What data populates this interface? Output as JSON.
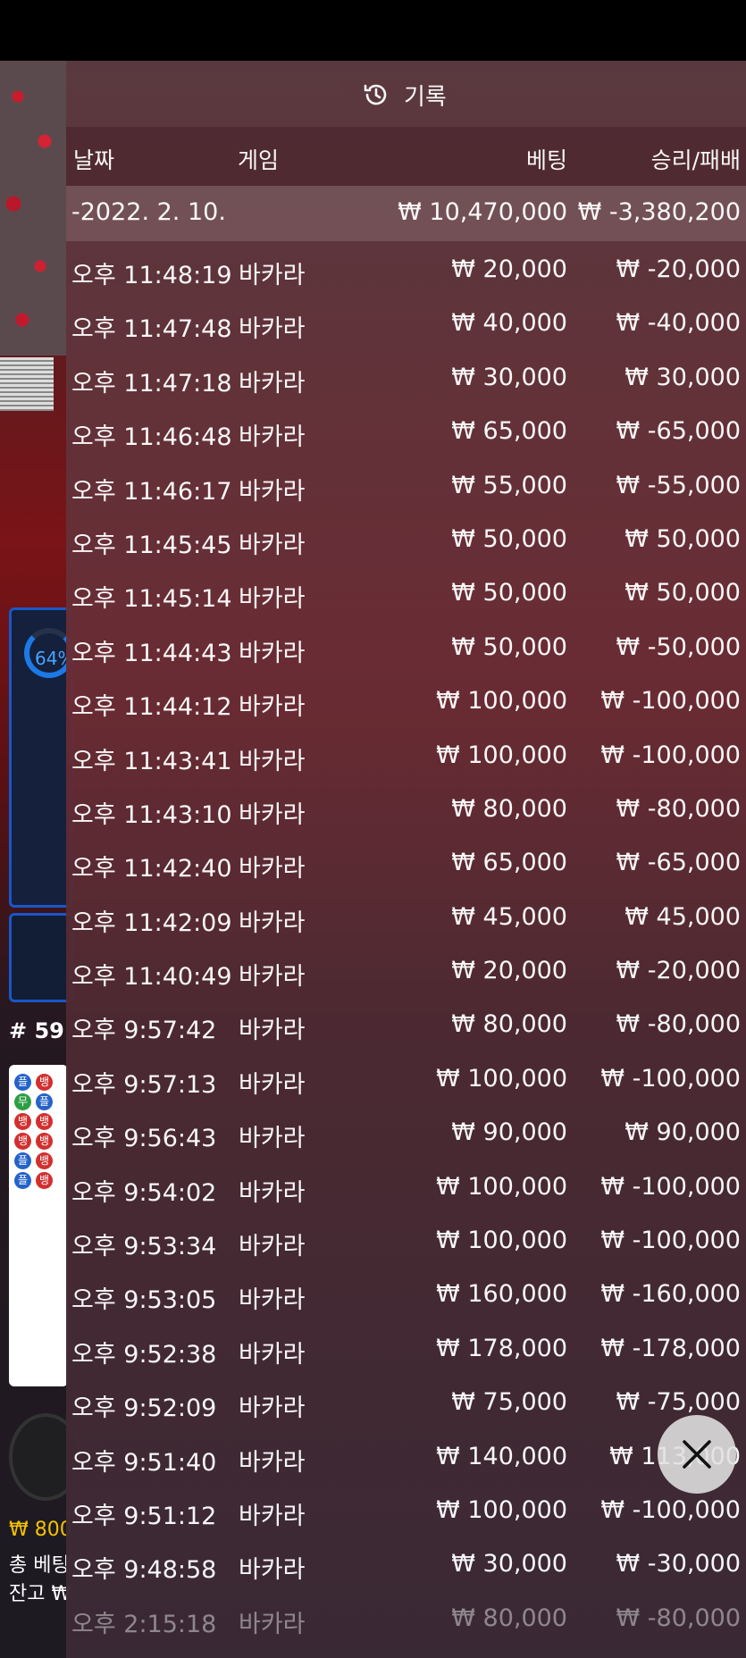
{
  "header": {
    "title": "기록",
    "icon": "history-clock-icon"
  },
  "columns": {
    "date": "날짜",
    "game": "게임",
    "bet": "베팅",
    "result": "승리/패배"
  },
  "summary": {
    "date": "-2022. 2. 10.",
    "bet": "₩ 10,470,000",
    "result": "₩ -3,380,200"
  },
  "rows": [
    {
      "time": "오후 11:48:19",
      "game": "바카라",
      "bet": "₩ 20,000",
      "result": "₩ -20,000"
    },
    {
      "time": "오후 11:47:48",
      "game": "바카라",
      "bet": "₩ 40,000",
      "result": "₩ -40,000"
    },
    {
      "time": "오후 11:47:18",
      "game": "바카라",
      "bet": "₩ 30,000",
      "result": "₩ 30,000"
    },
    {
      "time": "오후 11:46:48",
      "game": "바카라",
      "bet": "₩ 65,000",
      "result": "₩ -65,000"
    },
    {
      "time": "오후 11:46:17",
      "game": "바카라",
      "bet": "₩ 55,000",
      "result": "₩ -55,000"
    },
    {
      "time": "오후 11:45:45",
      "game": "바카라",
      "bet": "₩ 50,000",
      "result": "₩ 50,000"
    },
    {
      "time": "오후 11:45:14",
      "game": "바카라",
      "bet": "₩ 50,000",
      "result": "₩ 50,000"
    },
    {
      "time": "오후 11:44:43",
      "game": "바카라",
      "bet": "₩ 50,000",
      "result": "₩ -50,000"
    },
    {
      "time": "오후 11:44:12",
      "game": "바카라",
      "bet": "₩ 100,000",
      "result": "₩ -100,000"
    },
    {
      "time": "오후 11:43:41",
      "game": "바카라",
      "bet": "₩ 100,000",
      "result": "₩ -100,000"
    },
    {
      "time": "오후 11:43:10",
      "game": "바카라",
      "bet": "₩ 80,000",
      "result": "₩ -80,000"
    },
    {
      "time": "오후 11:42:40",
      "game": "바카라",
      "bet": "₩ 65,000",
      "result": "₩ -65,000"
    },
    {
      "time": "오후 11:42:09",
      "game": "바카라",
      "bet": "₩ 45,000",
      "result": "₩ 45,000"
    },
    {
      "time": "오후 11:40:49",
      "game": "바카라",
      "bet": "₩ 20,000",
      "result": "₩ -20,000"
    },
    {
      "time": "오후 9:57:42",
      "game": "바카라",
      "bet": "₩ 80,000",
      "result": "₩ -80,000"
    },
    {
      "time": "오후 9:57:13",
      "game": "바카라",
      "bet": "₩ 100,000",
      "result": "₩ -100,000"
    },
    {
      "time": "오후 9:56:43",
      "game": "바카라",
      "bet": "₩ 90,000",
      "result": "₩ 90,000"
    },
    {
      "time": "오후 9:54:02",
      "game": "바카라",
      "bet": "₩ 100,000",
      "result": "₩ -100,000"
    },
    {
      "time": "오후 9:53:34",
      "game": "바카라",
      "bet": "₩ 100,000",
      "result": "₩ -100,000"
    },
    {
      "time": "오후 9:53:05",
      "game": "바카라",
      "bet": "₩ 160,000",
      "result": "₩ -160,000"
    },
    {
      "time": "오후 9:52:38",
      "game": "바카라",
      "bet": "₩ 178,000",
      "result": "₩ -178,000"
    },
    {
      "time": "오후 9:52:09",
      "game": "바카라",
      "bet": "₩ 75,000",
      "result": "₩ -75,000"
    },
    {
      "time": "오후 9:51:40",
      "game": "바카라",
      "bet": "₩ 140,000",
      "result": "₩ 113,000"
    },
    {
      "time": "오후 9:51:12",
      "game": "바카라",
      "bet": "₩ 100,000",
      "result": "₩ -100,000"
    },
    {
      "time": "오후 9:48:58",
      "game": "바카라",
      "bet": "₩ 30,000",
      "result": "₩ -30,000"
    },
    {
      "time": "오후 2:15:18",
      "game": "바카라",
      "bet": "₩ 80,000",
      "result": "₩ -80,000"
    }
  ],
  "background": {
    "stat_percent": "64%",
    "round": "# 59",
    "balance": "₩ 800",
    "total_bet_label": "총 베팅",
    "remain_label": "잔고 ₩"
  },
  "close_button": {
    "icon": "close-icon"
  }
}
